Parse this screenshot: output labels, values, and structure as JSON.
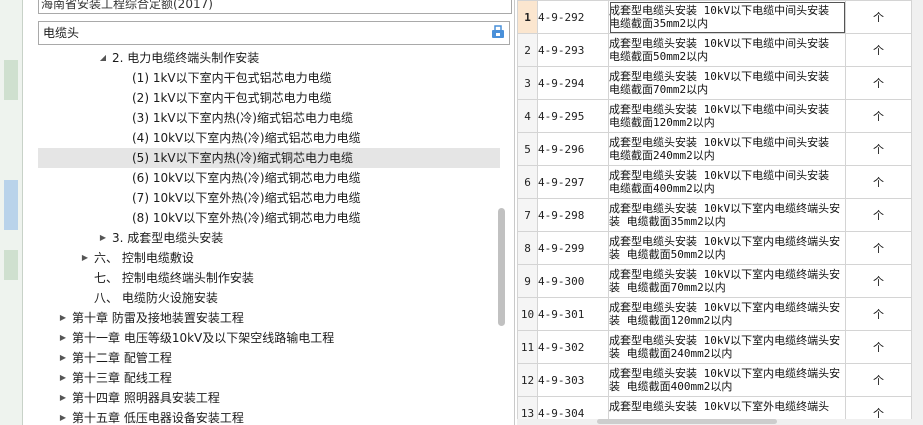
{
  "left_panel": {
    "library_dropdown": "海南省安装工程综合定额(2017)",
    "search": {
      "value": "电缆头",
      "placeholder": ""
    },
    "tree": [
      {
        "label": "2. 电力电缆终端头制作安装",
        "level": 3,
        "expanded": true,
        "has_children": true
      },
      {
        "label": "(1) 1kV以下室内干包式铝芯电力电缆",
        "level": 4,
        "has_children": false
      },
      {
        "label": "(2) 1kV以下室内干包式铜芯电力电缆",
        "level": 4,
        "has_children": false
      },
      {
        "label": "(3) 1kV以下室内热(冷)缩式铝芯电力电缆",
        "level": 4,
        "has_children": false
      },
      {
        "label": "(4) 10kV以下室内热(冷)缩式铝芯电力电缆",
        "level": 4,
        "has_children": false
      },
      {
        "label": "(5) 1kV以下室内热(冷)缩式铜芯电力电缆",
        "level": 4,
        "has_children": false,
        "selected": true
      },
      {
        "label": "(6) 10kV以下室内热(冷)缩式铜芯电力电缆",
        "level": 4,
        "has_children": false
      },
      {
        "label": "(7) 10kV以下室外热(冷)缩式铝芯电力电缆",
        "level": 4,
        "has_children": false
      },
      {
        "label": "(8) 10kV以下室外热(冷)缩式铜芯电力电缆",
        "level": 4,
        "has_children": false
      },
      {
        "label": "3. 成套型电缆头安装",
        "level": 3,
        "expanded": false,
        "has_children": true
      },
      {
        "label": "六、 控制电缆敷设",
        "level": 2,
        "expanded": false,
        "has_children": true
      },
      {
        "label": "七、 控制电缆终端头制作安装",
        "level": 2,
        "has_children": false
      },
      {
        "label": "八、 电缆防火设施安装",
        "level": 2,
        "has_children": false
      },
      {
        "label": "第十章 防雷及接地装置安装工程",
        "level": 1,
        "expanded": false,
        "has_children": true
      },
      {
        "label": "第十一章 电压等级10kV及以下架空线路输电工程",
        "level": 1,
        "expanded": false,
        "has_children": true
      },
      {
        "label": "第十二章 配管工程",
        "level": 1,
        "expanded": false,
        "has_children": true
      },
      {
        "label": "第十三章 配线工程",
        "level": 1,
        "expanded": false,
        "has_children": true
      },
      {
        "label": "第十四章 照明器具安装工程",
        "level": 1,
        "expanded": false,
        "has_children": true
      },
      {
        "label": "第十五章 低压电器设备安装工程",
        "level": 1,
        "expanded": false,
        "has_children": true
      }
    ]
  },
  "table": {
    "rows": [
      {
        "num": "1",
        "code": "4-9-292",
        "name": "成套型电缆头安装 10kV以下电缆中间头安装 电缆截面35mm2以内",
        "unit": "个",
        "active": true
      },
      {
        "num": "2",
        "code": "4-9-293",
        "name": "成套型电缆头安装 10kV以下电缆中间头安装 电缆截面50mm2以内",
        "unit": "个"
      },
      {
        "num": "3",
        "code": "4-9-294",
        "name": "成套型电缆头安装 10kV以下电缆中间头安装 电缆截面70mm2以内",
        "unit": "个"
      },
      {
        "num": "4",
        "code": "4-9-295",
        "name": "成套型电缆头安装 10kV以下电缆中间头安装 电缆截面120mm2以内",
        "unit": "个"
      },
      {
        "num": "5",
        "code": "4-9-296",
        "name": "成套型电缆头安装 10kV以下电缆中间头安装 电缆截面240mm2以内",
        "unit": "个"
      },
      {
        "num": "6",
        "code": "4-9-297",
        "name": "成套型电缆头安装 10kV以下电缆中间头安装 电缆截面400mm2以内",
        "unit": "个"
      },
      {
        "num": "7",
        "code": "4-9-298",
        "name": "成套型电缆头安装 10kV以下室内电缆终端头安装 电缆截面35mm2以内",
        "unit": "个"
      },
      {
        "num": "8",
        "code": "4-9-299",
        "name": "成套型电缆头安装 10kV以下室内电缆终端头安装 电缆截面50mm2以内",
        "unit": "个"
      },
      {
        "num": "9",
        "code": "4-9-300",
        "name": "成套型电缆头安装 10kV以下室内电缆终端头安装 电缆截面70mm2以内",
        "unit": "个"
      },
      {
        "num": "10",
        "code": "4-9-301",
        "name": "成套型电缆头安装 10kV以下室内电缆终端头安装 电缆截面120mm2以内",
        "unit": "个"
      },
      {
        "num": "11",
        "code": "4-9-302",
        "name": "成套型电缆头安装 10kV以下室内电缆终端头安装 电缆截面240mm2以内",
        "unit": "个"
      },
      {
        "num": "12",
        "code": "4-9-303",
        "name": "成套型电缆头安装 10kV以下室内电缆终端头安装 电缆截面400mm2以内",
        "unit": "个"
      },
      {
        "num": "13",
        "code": "4-9-304",
        "name": "成套型电缆头安装 10kV以下室外电缆终端头",
        "unit": "个"
      }
    ]
  }
}
